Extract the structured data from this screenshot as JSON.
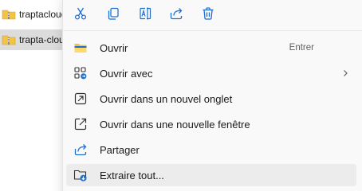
{
  "files": [
    {
      "name": "traptacloud",
      "selected": false
    },
    {
      "name": "trapta-cloud",
      "selected": true
    }
  ],
  "toolbar": {
    "cut_icon": "scissors-icon",
    "copy_icon": "copy-icon",
    "rename_icon": "rename-icon",
    "share_icon": "share-icon",
    "delete_icon": "trash-icon"
  },
  "menu": {
    "items": [
      {
        "label": "Ouvrir",
        "shortcut": "Entrer",
        "icon": "folder-icon"
      },
      {
        "label": "Ouvrir avec",
        "icon": "open-with-icon",
        "has_submenu": true
      },
      {
        "label": "Ouvrir dans un nouvel onglet",
        "icon": "new-tab-icon"
      },
      {
        "label": "Ouvrir dans une nouvelle fenêtre",
        "icon": "new-window-icon"
      },
      {
        "label": "Partager",
        "icon": "share-icon"
      },
      {
        "label": "Extraire tout...",
        "icon": "extract-icon",
        "highlighted": true
      }
    ]
  },
  "colors": {
    "menu_bg": "#f9f9f9",
    "hover_bg": "#ececec",
    "accent_blue": "#1f6fd1",
    "folder_yellow": "#f4c244",
    "selected_row": "#dcdcdc"
  }
}
